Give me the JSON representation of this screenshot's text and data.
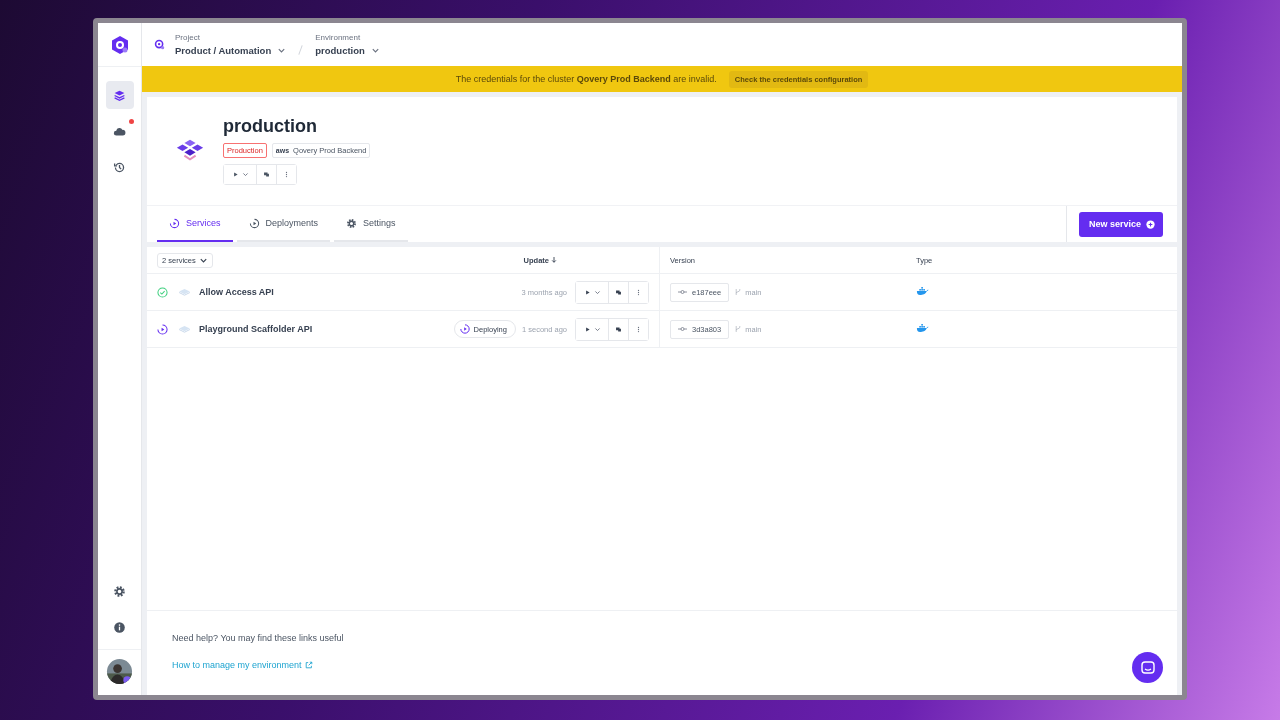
{
  "header": {
    "project_label": "Project",
    "project": "Product / Automation",
    "environment_label": "Environment",
    "environment": "production"
  },
  "sidebar": {
    "items": [
      {
        "kind": "layers",
        "selected": true,
        "notification": false
      },
      {
        "kind": "cloud",
        "selected": false,
        "notification": true
      },
      {
        "kind": "history",
        "selected": false,
        "notification": false
      }
    ],
    "bottom": [
      {
        "kind": "settings"
      },
      {
        "kind": "info"
      }
    ]
  },
  "banner": {
    "text": "The credentials for the cluster **Qovery Prod Backend** are invalid.",
    "action": "Check the credentials configuration"
  },
  "environment": {
    "title": "production",
    "tags": [
      {
        "kind": "mode",
        "label": "Production"
      },
      {
        "kind": "cluster",
        "provider": "aws",
        "label": "Qovery Prod Backend"
      }
    ]
  },
  "tabs": [
    {
      "kind": "services",
      "label": "Services",
      "selected": true
    },
    {
      "kind": "deployments",
      "label": "Deployments",
      "selected": false
    },
    {
      "kind": "settings",
      "label": "Settings",
      "selected": false
    }
  ],
  "new_service": "New service",
  "table": {
    "filter": "2 services",
    "columns": {
      "update": "Update",
      "version": "Version",
      "type": "Type"
    },
    "rows": [
      {
        "name": "Allow Access API",
        "kind": "ok",
        "time": "3 months ago",
        "commit": "e187eee",
        "branch": "main"
      },
      {
        "name": "Playground Scaffolder API",
        "kind": "deploying",
        "badge": "Deploying",
        "time": "1 second ago",
        "commit": "3d3a803",
        "branch": "main"
      }
    ]
  },
  "help": {
    "text": "Need help? You may find these links useful",
    "link": "How to manage my environment"
  }
}
